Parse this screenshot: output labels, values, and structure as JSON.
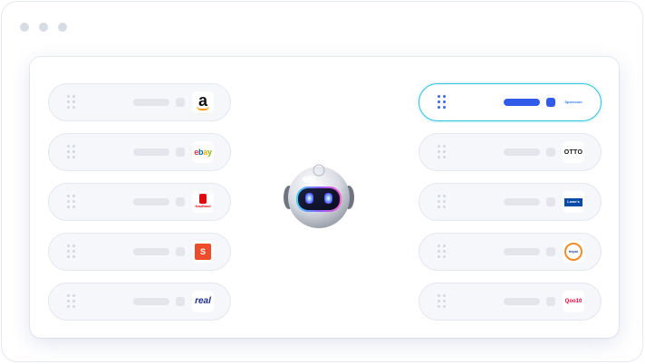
{
  "window": {
    "controls": [
      "dot",
      "dot",
      "dot"
    ]
  },
  "left_channels": [
    {
      "logo": "amazon-icon",
      "logo_text": "a"
    },
    {
      "logo": "ebay-icon",
      "logo_text": "ebay"
    },
    {
      "logo": "kaufland-icon",
      "logo_text": "Kaufland"
    },
    {
      "logo": "shopee-icon",
      "logo_text": "S"
    },
    {
      "logo": "real-icon",
      "logo_text": "real"
    }
  ],
  "right_channels": [
    {
      "logo": "allegro-icon",
      "logo_text": "Spreecom",
      "active": true
    },
    {
      "logo": "otto-icon",
      "logo_text": "OTTO",
      "active": false
    },
    {
      "logo": "lowes-icon",
      "logo_text": "Lowe's",
      "active": false
    },
    {
      "logo": "hepsiburada-icon",
      "logo_text": "hepsi",
      "active": false
    },
    {
      "logo": "qoo10-icon",
      "logo_text": "Qoo10",
      "active": false
    }
  ],
  "center": {
    "icon": "robot-icon"
  },
  "colors": {
    "accent_blue": "#2f5be8",
    "active_border": "#2ec1df",
    "placeholder_gray": "#e3e5ea",
    "row_bg": "#f6f7fa"
  }
}
